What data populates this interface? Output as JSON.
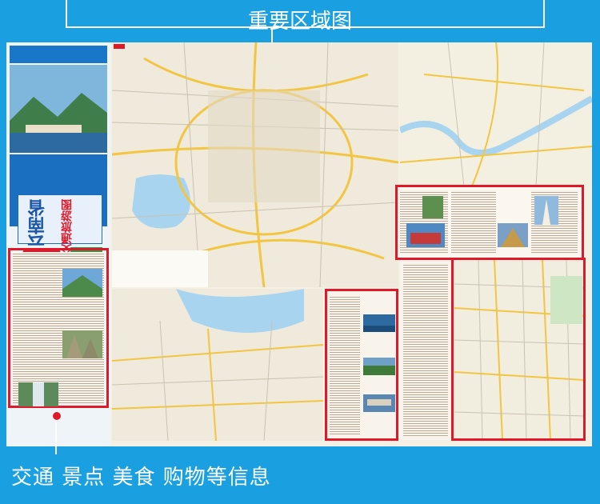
{
  "top_label": "重要区域图",
  "bottom_label": "交通 景点 美食 购物等信息",
  "cover": {
    "title_vertical": "云南省",
    "subtitle_vertical": "交通旅游图"
  },
  "colors": {
    "background": "#1aa0e0",
    "highlight": "#e0192a",
    "road_major": "#f2c542",
    "water": "#a9d4ef"
  }
}
